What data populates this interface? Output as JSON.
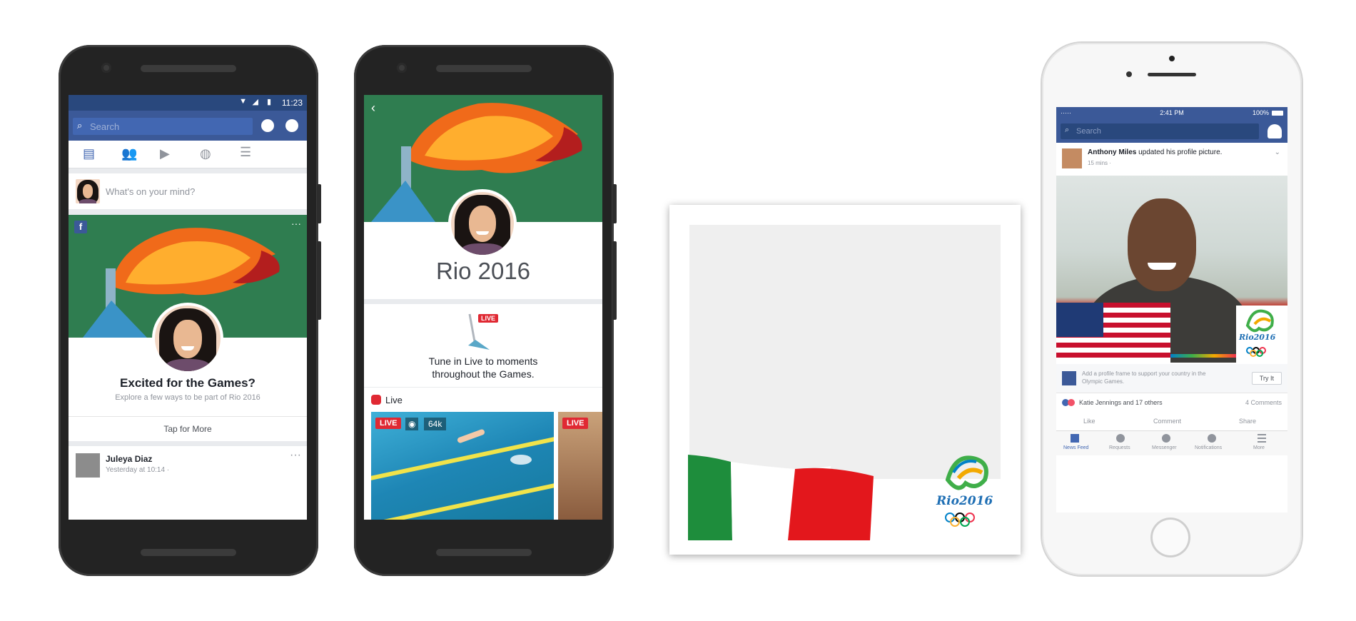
{
  "phone1": {
    "status_time": "11:23",
    "search_placeholder": "Search",
    "composer_prompt": "What's on your mind?",
    "promo_title": "Excited for the Games?",
    "promo_subtitle": "Explore a few ways to be part of Rio 2016",
    "promo_cta": "Tap for More",
    "post_author": "Juleya Diaz",
    "post_time": "Yesterday at 10:14 · ",
    "menu_dots": "···"
  },
  "phone2": {
    "page_title": "Rio 2016",
    "live_flag": "LIVE",
    "tune_in_text_line1": "Tune in Live to moments",
    "tune_in_text_line2": "throughout the Games.",
    "live_section_label": "Live",
    "live_badge": "LIVE",
    "viewer_count": "64k",
    "live_badge_2": "LIVE"
  },
  "frame": {
    "logo_text": "Rio2016"
  },
  "iphone": {
    "carrier": "·····",
    "status_time": "2:41 PM",
    "battery": "100%",
    "search_placeholder": "Search",
    "post_author": "Anthony Miles",
    "post_action": " updated his profile picture.",
    "post_meta": "15 mins · ",
    "logo_text": "Rio2016",
    "promo_text": "Add a profile frame to support your country in the Olympic Games.",
    "try_button": "Try It",
    "reactions_text": "Katie Jennings and 17 others",
    "comments_count": "4 Comments",
    "actions": [
      "Like",
      "Comment",
      "Share"
    ],
    "tabbar": [
      "News Feed",
      "Requests",
      "Messenger",
      "Notifications",
      "More"
    ]
  },
  "colors": {
    "fb_blue": "#3b5998",
    "status_blue": "#29487d",
    "live_red": "#e02933",
    "pitch_green": "#2f7d50"
  }
}
